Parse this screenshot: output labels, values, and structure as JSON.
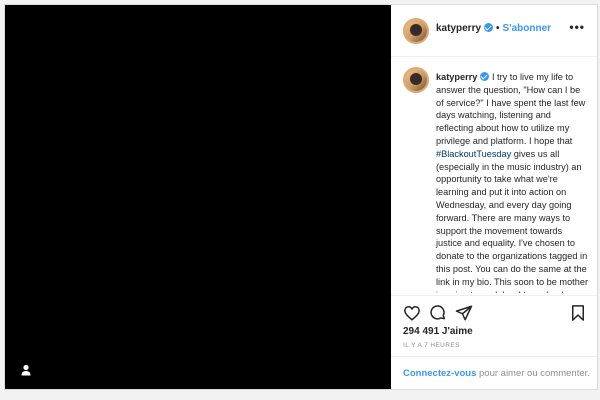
{
  "post": {
    "header": {
      "username": "katyperry",
      "separator": "•",
      "follow_label": "S'abonner",
      "more_icon": "more-horizontal-icon"
    },
    "caption": {
      "username": "katyperry",
      "text_before": "I try to live my life to answer the question, \"How can I be of service?\" I have spent the last few days watching, listening and reflecting about how to utilize my privilege and platform. I hope that ",
      "hashtag": "#BlackoutTuesday",
      "text_after": " gives us all (especially in the music industry) an opportunity to take what we're learning and put it into action on Wednesday, and every day going forward. There are many ways to support the movement towards justice and equality. I've chosen to donate to the organizations tagged in this post. You can do the same at the link in my bio. This soon to be mother is going to work hard to make damn sure this world is a more just place for every child. Black Lives Matter."
    },
    "actions": {
      "like_icon": "heart-icon",
      "comment_icon": "comment-icon",
      "share_icon": "share-icon",
      "save_icon": "bookmark-icon"
    },
    "likes": "294 491 J'aime",
    "time_ago": "IL Y A 7 HEURES",
    "add_comment": {
      "login_link": "Connectez-vous",
      "rest": " pour aimer ou commenter."
    },
    "colors": {
      "link_blue": "#3897f0",
      "hashtag": "#00376b",
      "media_bg": "#000000"
    }
  }
}
